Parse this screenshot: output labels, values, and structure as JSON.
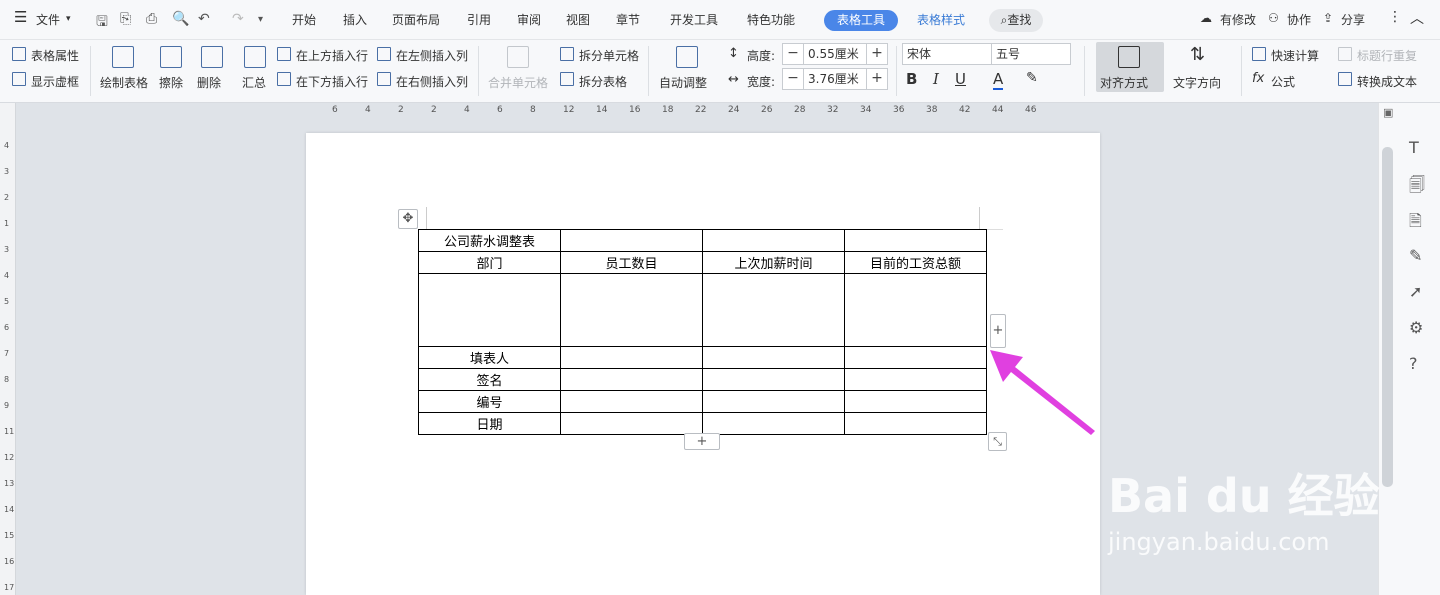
{
  "menubar": {
    "file": "文件",
    "tabs": [
      "开始",
      "插入",
      "页面布局",
      "引用",
      "审阅",
      "视图",
      "章节",
      "开发工具",
      "特色功能"
    ],
    "active_tab": "表格工具",
    "style_tab": "表格样式",
    "search": "查找",
    "right": {
      "modified": "有修改",
      "collab": "协作",
      "share": "分享"
    }
  },
  "ribbon": {
    "table_props": "表格属性",
    "show_grid": "显示虚框",
    "draw_table": "绘制表格",
    "erase": "擦除",
    "delete": "删除",
    "summary": "汇总",
    "insert_above": "在上方插入行",
    "insert_below": "在下方插入行",
    "insert_left": "在左侧插入列",
    "insert_right": "在右侧插入列",
    "merge": "合并单元格",
    "split_cell": "拆分单元格",
    "split_table": "拆分表格",
    "auto_fit": "自动调整",
    "height_label": "高度:",
    "height_value": "0.55厘米",
    "width_label": "宽度:",
    "width_value": "3.76厘米",
    "font": "宋体",
    "size": "五号",
    "align": "对齐方式",
    "text_dir": "文字方向",
    "quick_calc": "快速计算",
    "repeat_header": "标题行重复",
    "formula": "公式",
    "to_text": "转换成文本"
  },
  "ruler": [
    "6",
    "4",
    "2",
    "2",
    "4",
    "6",
    "8",
    "12",
    "14",
    "16",
    "18",
    "22",
    "24",
    "26",
    "28",
    "32",
    "34",
    "36",
    "38",
    "42",
    "44",
    "46"
  ],
  "vruler": [
    "4",
    "3",
    "2",
    "1",
    "3",
    "4",
    "5",
    "6",
    "7",
    "8",
    "9",
    "11",
    "12",
    "13",
    "14",
    "15",
    "16",
    "17"
  ],
  "table": {
    "rows": [
      [
        "公司薪水调整表",
        "",
        "",
        ""
      ],
      [
        "部门",
        "员工数目",
        "上次加薪时间",
        "目前的工资总额"
      ],
      [
        "",
        "",
        "",
        ""
      ],
      [
        "填表人",
        "",
        "",
        ""
      ],
      [
        "签名",
        "",
        "",
        ""
      ],
      [
        "编号",
        "",
        "",
        ""
      ],
      [
        "日期",
        "",
        "",
        ""
      ]
    ]
  },
  "watermark": {
    "brand": "Bai du 经验",
    "url": "jingyan.baidu.com"
  },
  "colors": {
    "accent": "#4a86e8",
    "arrow": "#e040e0"
  }
}
